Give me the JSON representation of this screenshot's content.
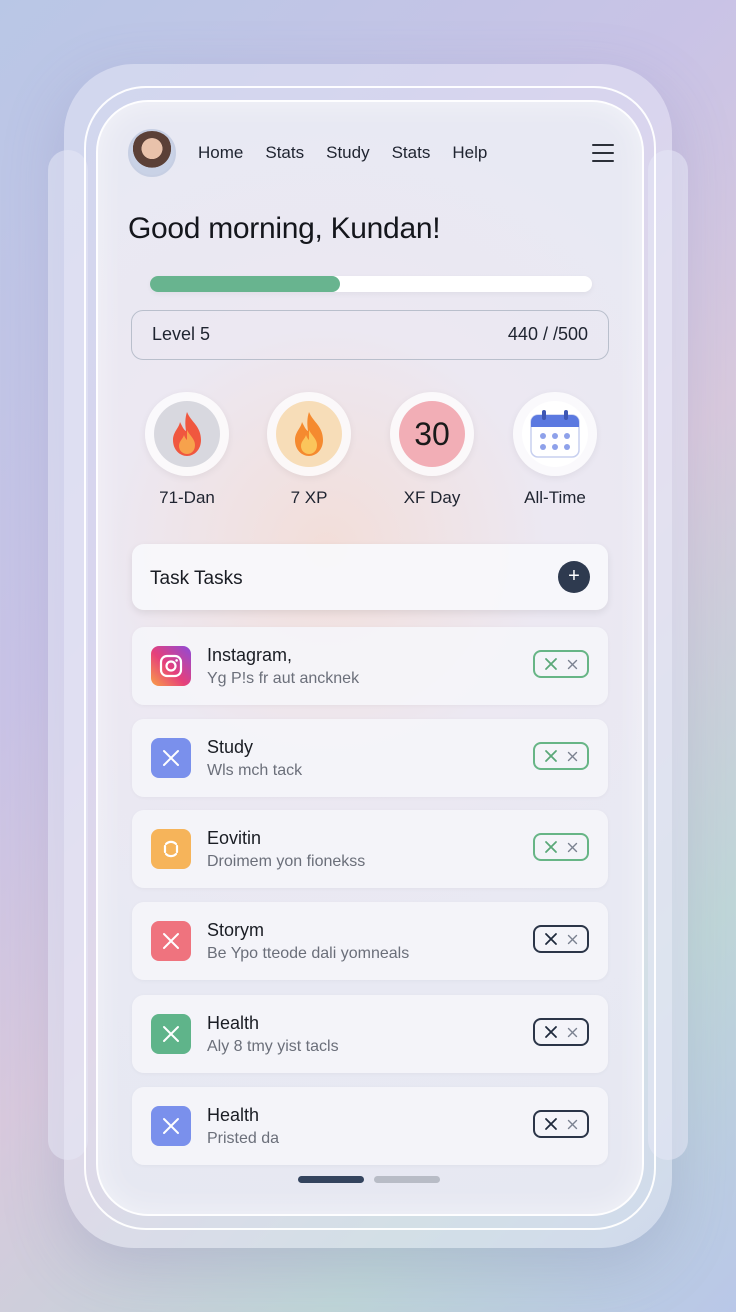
{
  "nav": {
    "links": [
      "Home",
      "Stats",
      "Study",
      "Stats",
      "Help"
    ]
  },
  "greeting": "Good morning, Kundan!",
  "progress": {
    "fraction": 0.43,
    "level_label": "Level 5",
    "xp_text": "440 / /500"
  },
  "stats": [
    {
      "label": "71-Dan",
      "icon": "flame-icon",
      "ring": "#d8d8df"
    },
    {
      "label": "7 XP",
      "icon": "flame-icon",
      "ring": "#f7ddb8"
    },
    {
      "label": "XF Day",
      "value": "30",
      "ring": "#f2aeb6"
    },
    {
      "label": "All-Time",
      "icon": "calendar-icon",
      "ring": "#ffffff"
    }
  ],
  "tasks_header": {
    "title": "Task Tasks",
    "add_label": "+"
  },
  "tasks": [
    {
      "title": "Instagram,",
      "subtitle": "Yg P!s fr aut ancknek",
      "icon": "instagram-icon",
      "state": "green"
    },
    {
      "title": "Study",
      "subtitle": "Wls mch tack",
      "icon": "close-icon",
      "icon_color": "#7a90ec",
      "state": "green"
    },
    {
      "title": "Eovitin",
      "subtitle": "Droimem yon fionekss",
      "icon": "refresh-icon",
      "icon_color": "#f6b45a",
      "state": "green"
    },
    {
      "title": "Storym",
      "subtitle": "Be Ypo ttеode dali yomneals",
      "icon": "close-icon",
      "icon_color": "#ef737e",
      "state": "dark"
    },
    {
      "title": "Health",
      "subtitle": "Aly 8 tmy yist tacls",
      "icon": "close-icon",
      "icon_color": "#5fb48a",
      "state": "dark"
    },
    {
      "title": "Health",
      "subtitle": "Pristed da",
      "icon": "close-icon",
      "icon_color": "#7a90ec",
      "state": "dark"
    }
  ],
  "colors": {
    "accent_green": "#68b48f",
    "dark_navy": "#2e3a4f"
  }
}
